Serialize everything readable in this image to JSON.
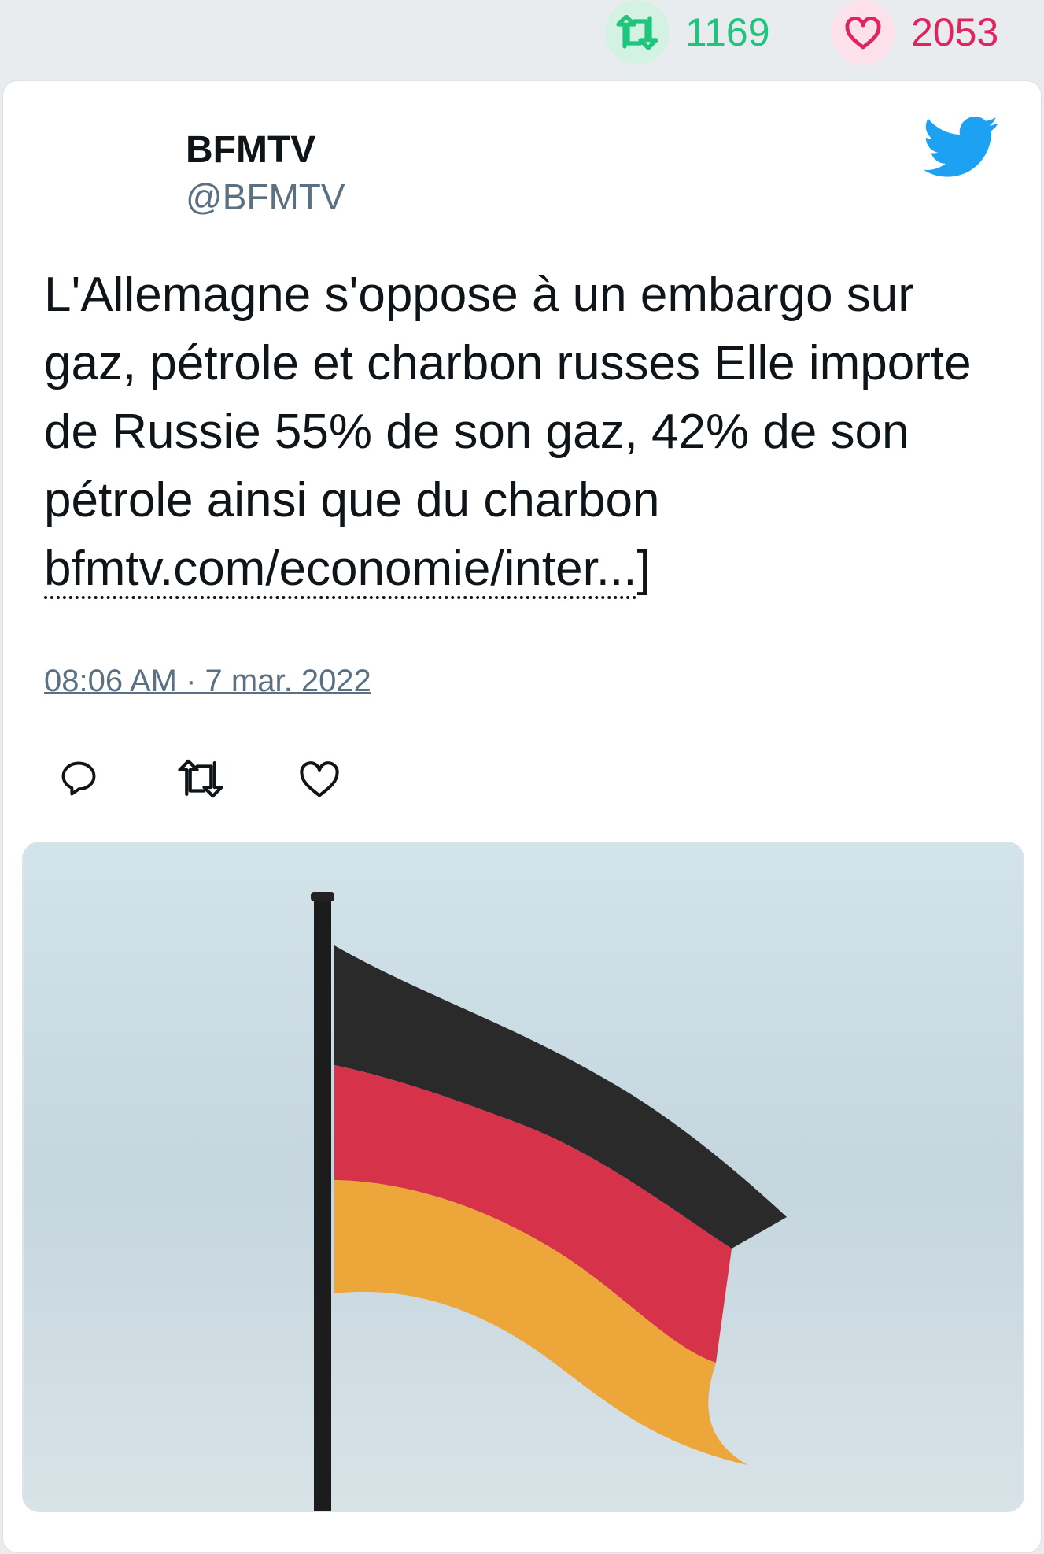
{
  "stats": {
    "retweets": "1169",
    "likes": "2053",
    "retweet_color": "#1ec57b",
    "like_color": "#e0245e"
  },
  "tweet": {
    "author_name": "BFMTV",
    "author_handle": "@BFMTV",
    "text": "L'Allemagne s'oppose à un embargo sur gaz, pétrole et charbon russes Elle importe de Russie 55% de son gaz, 42% de son pétrole ainsi que du charbon",
    "link_text": "bfmtv.com/economie/inter...",
    "link_suffix": "]",
    "timestamp": "08:06 AM · 7 mar. 2022"
  },
  "icons": {
    "brand": "twitter-bird-icon",
    "actions": [
      "reply-icon",
      "retweet-icon",
      "like-icon"
    ]
  },
  "brand_color": "#1da1f2"
}
